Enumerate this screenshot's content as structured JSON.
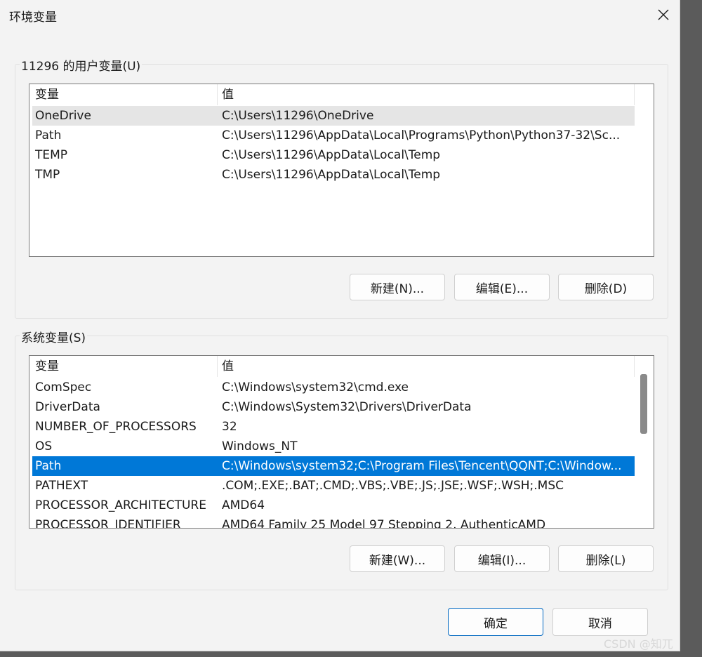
{
  "window": {
    "title": "环境变量",
    "close_icon": "close-icon"
  },
  "user_vars": {
    "group_label": "11296 的用户变量(U)",
    "columns": [
      "变量",
      "值"
    ],
    "rows": [
      {
        "name": "OneDrive",
        "value": "C:\\Users\\11296\\OneDrive"
      },
      {
        "name": "Path",
        "value": "C:\\Users\\11296\\AppData\\Local\\Programs\\Python\\Python37-32\\Sc..."
      },
      {
        "name": "TEMP",
        "value": "C:\\Users\\11296\\AppData\\Local\\Temp"
      },
      {
        "name": "TMP",
        "value": "C:\\Users\\11296\\AppData\\Local\\Temp"
      }
    ],
    "buttons": {
      "new": "新建(N)...",
      "edit": "编辑(E)...",
      "delete": "删除(D)"
    }
  },
  "system_vars": {
    "group_label": "系统变量(S)",
    "columns": [
      "变量",
      "值"
    ],
    "rows": [
      {
        "name": "ComSpec",
        "value": "C:\\Windows\\system32\\cmd.exe"
      },
      {
        "name": "DriverData",
        "value": "C:\\Windows\\System32\\Drivers\\DriverData"
      },
      {
        "name": "NUMBER_OF_PROCESSORS",
        "value": "32"
      },
      {
        "name": "OS",
        "value": "Windows_NT"
      },
      {
        "name": "Path",
        "value": "C:\\Windows\\system32;C:\\Program Files\\Tencent\\QQNT;C:\\Window..."
      },
      {
        "name": "PATHEXT",
        "value": ".COM;.EXE;.BAT;.CMD;.VBS;.VBE;.JS;.JSE;.WSF;.WSH;.MSC"
      },
      {
        "name": "PROCESSOR_ARCHITECTURE",
        "value": "AMD64"
      },
      {
        "name": "PROCESSOR_IDENTIFIER",
        "value": "AMD64 Family 25 Model 97 Stepping 2, AuthenticAMD"
      }
    ],
    "buttons": {
      "new": "新建(W)...",
      "edit": "编辑(I)...",
      "delete": "删除(L)"
    }
  },
  "footer": {
    "ok": "确定",
    "cancel": "取消"
  },
  "watermark": "CSDN @知兀",
  "colors": {
    "selection": "#0078d7",
    "hover_row": "#e5e5e5",
    "dialog_bg": "#f3f3f3"
  }
}
